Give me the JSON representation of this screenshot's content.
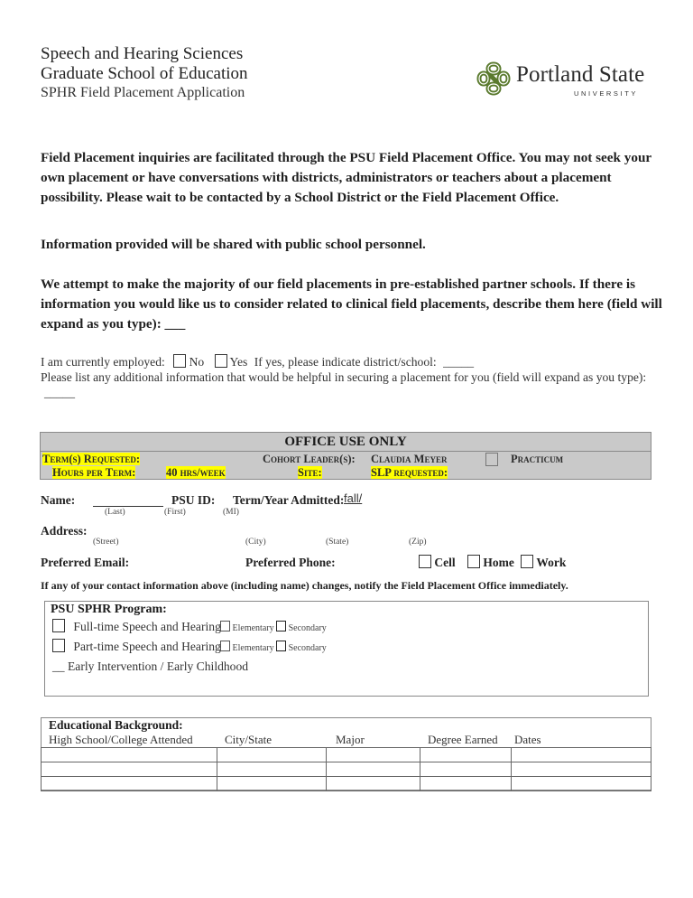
{
  "header": {
    "line1": "Speech and Hearing Sciences",
    "line2": "Graduate School of Education",
    "line3": "SPHR Field Placement Application",
    "logo": {
      "icon": "psu-knot-logo-icon",
      "name": "Portland State",
      "sub": "UNIVERSITY",
      "color": "#5a7a2e"
    }
  },
  "intro": {
    "p1": "Field Placement inquiries are facilitated through the PSU Field Placement Office.  You may not seek your own placement or have conversations with districts, administrators or teachers about a placement possibility. Please wait to be contacted by a School District or the Field Placement Office.",
    "p2": "Information provided will be shared with public school personnel.",
    "p3": "We attempt to make the majority of our field placements in pre-established partner schools. If there is information you would like us to consider related to clinical field placements, describe them here (field will expand as you type): ___"
  },
  "employment": {
    "label": "I am currently employed:",
    "no_label": "No",
    "yes_label": "Yes",
    "district_prompt": "If yes, please indicate district/school:",
    "district_value": "_____",
    "additional_prompt": "Please list any additional information that would be helpful in securing a placement for you (field will expand as you type):",
    "additional_value": "_____"
  },
  "office": {
    "title": "OFFICE USE ONLY",
    "terms_label": "Term(s) Requested:",
    "cohort_label": "Cohort Leader(s):",
    "cohort_value": "Claudia Meyer",
    "practicum_label": "Practicum",
    "hours_label": "Hours per Term:",
    "hours_value": "40 hrs/week",
    "site_label": "Site:",
    "slp_label": "SLP requested:",
    "highlight_color": "#ffff00",
    "background_color": "#c9c9c9"
  },
  "contact": {
    "name_label": "Name:",
    "psu_id_label": "PSU ID:",
    "term_label": "Term/Year Admitted:",
    "term_value": "fall/",
    "last": "(Last)",
    "first": "(First)",
    "mi": "(MI)",
    "address_label": "Address:",
    "street": "(Street)",
    "city": "(City)",
    "state": "(State)",
    "zip": "(Zip)",
    "email_label": "Preferred Email:",
    "phone_label": "Preferred Phone:",
    "cell": "Cell",
    "home": "Home",
    "work": "Work",
    "notice": "If any of your contact information above (including name) changes, notify the Field Placement Office immediately."
  },
  "program": {
    "title": "PSU SPHR Program:",
    "fulltime": "Full-time Speech and Hearing",
    "parttime": "Part-time Speech and Hearing",
    "elementary": "Elementary",
    "secondary": "Secondary",
    "early": "__ Early Intervention / Early Childhood"
  },
  "education": {
    "title": "Educational Background:",
    "columns": [
      "High School/College Attended",
      "City/State",
      "Major",
      "Degree Earned",
      "Dates"
    ],
    "rows": [
      [
        "",
        "",
        "",
        "",
        ""
      ],
      [
        "",
        "",
        "",
        "",
        ""
      ],
      [
        "",
        "",
        "",
        "",
        ""
      ]
    ]
  }
}
